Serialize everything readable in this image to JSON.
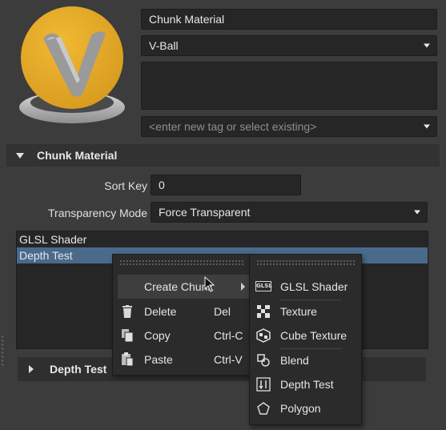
{
  "asset": {
    "name": "Chunk Material",
    "type_selected": "V-Ball",
    "tags_placeholder": "<enter new tag or select existing>"
  },
  "section": {
    "title": "Chunk Material",
    "sort_key_label": "Sort Key",
    "sort_key_value": "0",
    "transparency_label": "Transparency Mode",
    "transparency_value": "Force Transparent"
  },
  "chunks": [
    "GLSL Shader",
    "Depth Test"
  ],
  "depth_section": {
    "title": "Depth Test"
  },
  "context_menu": {
    "items": [
      {
        "label": "Create Chunk",
        "shortcut": ""
      },
      {
        "label": "Delete",
        "shortcut": "Del"
      },
      {
        "label": "Copy",
        "shortcut": "Ctrl-C"
      },
      {
        "label": "Paste",
        "shortcut": "Ctrl-V"
      }
    ]
  },
  "submenu": {
    "items": [
      "GLSL Shader",
      "Texture",
      "Cube Texture",
      "Blend",
      "Depth Test",
      "Polygon"
    ]
  },
  "colors": {
    "background": "#3c3c3c",
    "field": "#262626",
    "selection": "#4a6a8c",
    "logo": "#e7ab2b"
  }
}
